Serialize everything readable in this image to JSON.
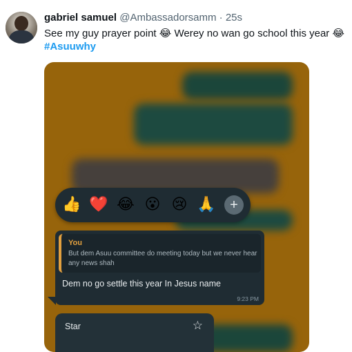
{
  "tweet": {
    "display_name": "gabriel samuel",
    "handle": "@Ambassadorsamm",
    "separator": "·",
    "time": "25s",
    "text_part1": "See my guy prayer point ",
    "text_part2": " Werey no wan go school this year ",
    "laugh_emoji": "😂",
    "hashtag": "#Asuuwhy"
  },
  "chat": {
    "reactions": [
      "👍",
      "❤️",
      "😂",
      "😮",
      "😢",
      "🙏"
    ],
    "plus_icon": "+",
    "reply": {
      "author": "You",
      "quoted_text": "But dem Asuu committee do meeting today but we never hear any news shah"
    },
    "message_text": "Dem no go settle this year In Jesus name",
    "message_time": "9:23 PM",
    "menu": {
      "item_label": "Star",
      "item_icon": "☆"
    }
  },
  "colors": {
    "link": "#1d9bf0",
    "chat_bubble": "#1f2c33",
    "quote_accent": "#e2a03f",
    "media_bg": "#a06a0c"
  }
}
